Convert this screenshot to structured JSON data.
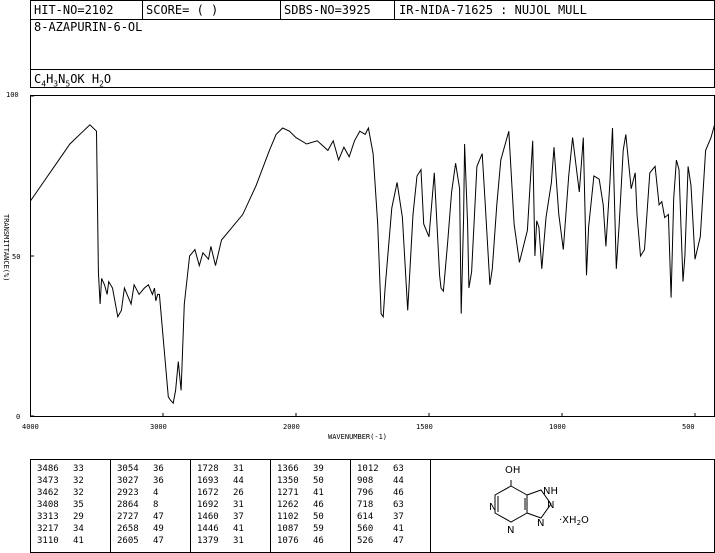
{
  "header": {
    "hit_no": "HIT-NO=2102",
    "score": "SCORE=  (   )",
    "sdbs_no": "SDBS-NO=3925",
    "ir_info": "IR-NIDA-71625 : NUJOL MULL",
    "compound_name": "8-AZAPURIN-6-OL",
    "formula": {
      "c": "C",
      "c_n": "4",
      "h": "H",
      "h_n": "3",
      "n": "N",
      "n_n": "5",
      "rest": "OK H",
      "h2_n": "2",
      "o": "O"
    }
  },
  "chart_data": {
    "type": "line",
    "xlabel": "WAVENUMBER(-1)",
    "ylabel": "TRANSMITTANCE(%)",
    "xlim": [
      4000,
      400
    ],
    "ylim": [
      0,
      100
    ],
    "x_ticks": [
      "4000",
      "3000",
      "2000",
      "1500",
      "1000",
      "500"
    ],
    "x_tick_values": [
      4000,
      3000,
      2000,
      1500,
      1000,
      500
    ],
    "y_ticks": [
      "100",
      "50",
      "0"
    ],
    "y_tick_values": [
      100,
      50,
      0
    ],
    "x": [
      4000,
      3900,
      3800,
      3700,
      3600,
      3550,
      3500,
      3486,
      3473,
      3462,
      3440,
      3420,
      3408,
      3380,
      3340,
      3313,
      3290,
      3260,
      3240,
      3217,
      3180,
      3140,
      3110,
      3080,
      3064,
      3054,
      3040,
      3027,
      3000,
      2960,
      2945,
      2923,
      2905,
      2885,
      2864,
      2840,
      2800,
      2760,
      2727,
      2700,
      2658,
      2640,
      2605,
      2560,
      2500,
      2400,
      2300,
      2200,
      2150,
      2100,
      2050,
      2000,
      1960,
      1920,
      1880,
      1860,
      1840,
      1820,
      1800,
      1780,
      1760,
      1740,
      1728,
      1710,
      1693,
      1680,
      1672,
      1665,
      1640,
      1620,
      1600,
      1580,
      1560,
      1545,
      1530,
      1520,
      1500,
      1480,
      1460,
      1455,
      1446,
      1430,
      1415,
      1400,
      1385,
      1379,
      1370,
      1366,
      1355,
      1350,
      1340,
      1320,
      1300,
      1290,
      1271,
      1262,
      1245,
      1230,
      1200,
      1180,
      1160,
      1130,
      1110,
      1102,
      1095,
      1087,
      1076,
      1060,
      1040,
      1030,
      1012,
      995,
      975,
      960,
      935,
      920,
      908,
      900,
      880,
      860,
      845,
      835,
      820,
      810,
      796,
      785,
      770,
      760,
      740,
      725,
      718,
      705,
      690,
      670,
      650,
      635,
      625,
      614,
      600,
      590,
      580,
      570,
      560,
      553,
      545,
      538,
      526,
      515,
      500,
      480,
      460,
      440,
      420,
      400
    ],
    "y": [
      67,
      73,
      79,
      85,
      89,
      91,
      89,
      45,
      35,
      43,
      41,
      38,
      42,
      40,
      31,
      33,
      40,
      37,
      35,
      41,
      38,
      40,
      41,
      38,
      40,
      36,
      38,
      38,
      25,
      6,
      5,
      4,
      8,
      17,
      8,
      35,
      50,
      52,
      47,
      51,
      49,
      53,
      47,
      55,
      58,
      63,
      72,
      83,
      88,
      90,
      89,
      87,
      85,
      86,
      83,
      86,
      80,
      84,
      81,
      86,
      89,
      88,
      90,
      82,
      60,
      32,
      31,
      40,
      65,
      73,
      62,
      33,
      63,
      75,
      77,
      60,
      56,
      76,
      44,
      40,
      39,
      54,
      70,
      79,
      71,
      32,
      62,
      85,
      60,
      40,
      45,
      78,
      82,
      68,
      41,
      46,
      66,
      80,
      89,
      60,
      48,
      58,
      86,
      50,
      61,
      59,
      46,
      62,
      73,
      84,
      63,
      52,
      75,
      87,
      70,
      87,
      44,
      59,
      75,
      74,
      66,
      53,
      73,
      90,
      46,
      60,
      83,
      88,
      71,
      76,
      63,
      50,
      52,
      76,
      78,
      66,
      67,
      62,
      63,
      37,
      68,
      80,
      77,
      60,
      42,
      50,
      78,
      72,
      49,
      56,
      83,
      87,
      93,
      94,
      91,
      86
    ]
  },
  "peaks": {
    "columns": [
      [
        [
          "3486",
          "33"
        ],
        [
          "3473",
          "32"
        ],
        [
          "3462",
          "32"
        ],
        [
          "3408",
          "35"
        ],
        [
          "3313",
          "29"
        ],
        [
          "3217",
          "34"
        ],
        [
          "3110",
          "41"
        ]
      ],
      [
        [
          "3054",
          "36"
        ],
        [
          "3027",
          "36"
        ],
        [
          "2923",
          "4"
        ],
        [
          "2864",
          "8"
        ],
        [
          "2727",
          "47"
        ],
        [
          "2658",
          "49"
        ],
        [
          "2605",
          "47"
        ]
      ],
      [
        [
          "1728",
          "31"
        ],
        [
          "1693",
          "44"
        ],
        [
          "1672",
          "26"
        ],
        [
          "1692",
          "31"
        ],
        [
          "1460",
          "37"
        ],
        [
          "1446",
          "41"
        ],
        [
          "1379",
          "31"
        ]
      ],
      [
        [
          "1366",
          "39"
        ],
        [
          "1350",
          "50"
        ],
        [
          "1271",
          "41"
        ],
        [
          "1262",
          "46"
        ],
        [
          "1102",
          "50"
        ],
        [
          "1087",
          "59"
        ],
        [
          "1076",
          "46"
        ]
      ],
      [
        [
          "1012",
          "63"
        ],
        [
          "908",
          "44"
        ],
        [
          "796",
          "46"
        ],
        [
          "718",
          "63"
        ],
        [
          "614",
          "37"
        ],
        [
          "560",
          "41"
        ],
        [
          "526",
          "47"
        ]
      ]
    ]
  },
  "structure": {
    "oh": "OH",
    "nh": "NH",
    "n1": "N",
    "n2": "N",
    "n3": "N",
    "n4": "N",
    "hydrate": "·XH",
    "hydrate_sub": "2",
    "hydrate_o": "O"
  }
}
